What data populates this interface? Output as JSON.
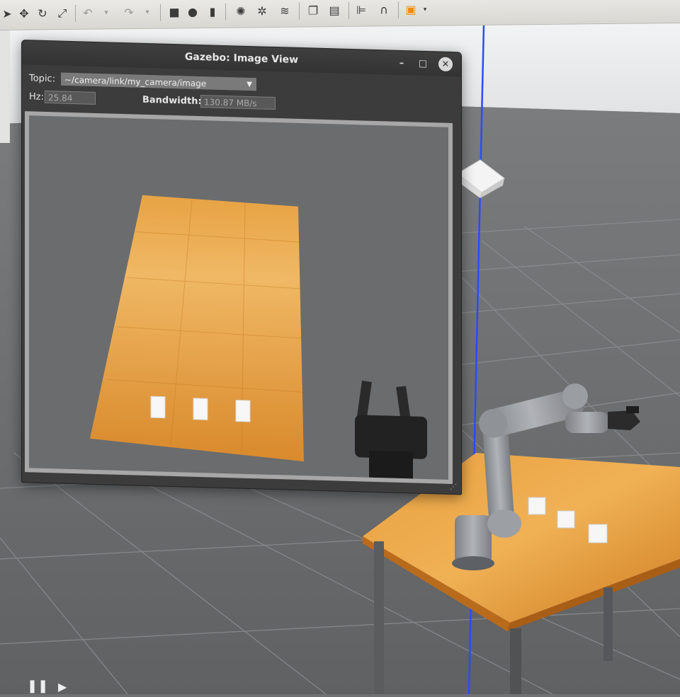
{
  "toolbar": {
    "icons": [
      "select-arrow-icon",
      "translate-icon",
      "rotate-icon",
      "scale-icon",
      "undo-icon",
      "redo-icon",
      "box-shape-icon",
      "sphere-shape-icon",
      "cylinder-shape-icon",
      "point-light-icon",
      "spot-light-icon",
      "directional-light-icon",
      "copy-icon",
      "paste-icon",
      "align-icon",
      "snap-icon",
      "view-angle-icon"
    ]
  },
  "image_view": {
    "title": "Gazebo: Image View",
    "topic_label": "Topic:",
    "topic_value": "~/camera/link/my_camera/image",
    "hz_label": "Hz:",
    "hz_value": "25.84",
    "bandwidth_label": "Bandwidth:",
    "bandwidth_value": "130.87 MB/s"
  },
  "colors": {
    "ground": "#6f7173",
    "table_wood": "#e08f2b",
    "z_axis": "#2a4bff",
    "robot_gray": "#8e9196"
  }
}
